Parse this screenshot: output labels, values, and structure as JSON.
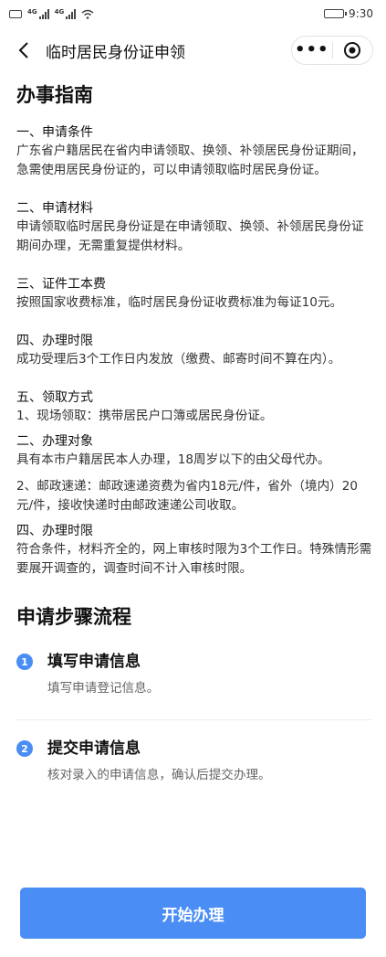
{
  "status_bar": {
    "time": "9:30",
    "battery_level": 0.85
  },
  "nav": {
    "title": "临时居民身份证申领",
    "more_icon": "more-dots-icon",
    "close_icon": "close-circle-icon"
  },
  "guide": {
    "title": "办事指南",
    "sections": [
      {
        "title": "一、申请条件",
        "body": "广东省户籍居民在省内申请领取、换领、补领居民身份证期间，急需使用居民身份证的，可以申请领取临时居民身份证。"
      },
      {
        "title": "二、申请材料",
        "body": "申请领取临时居民身份证是在申请领取、换领、补领居民身份证期间办理，无需重复提供材料。"
      },
      {
        "title": "三、证件工本费",
        "body": "按照国家收费标准，临时居民身份证收费标准为每证10元。"
      },
      {
        "title": "四、办理时限",
        "body": "成功受理后3个工作日内发放（缴费、邮寄时间不算在内）。"
      },
      {
        "title": "五、领取方式",
        "body": "1、现场领取：携带居民户口簿或居民身份证。"
      },
      {
        "title": "二、办理对象",
        "body": "具有本市户籍居民本人办理，18周岁以下的由父母代办。"
      },
      {
        "title": "",
        "body": "2、邮政速递：邮政速递资费为省内18元/件，省外（境内）20元/件，接收快递时由邮政速递公司收取。"
      },
      {
        "title": "四、办理时限",
        "body": "符合条件，材料齐全的，网上审核时限为3个工作日。特殊情形需要展开调查的，调查时间不计入审核时限。"
      }
    ]
  },
  "steps": {
    "title": "申请步骤流程",
    "items": [
      {
        "num": "1",
        "title": "填写申请信息",
        "desc": "填写申请登记信息。"
      },
      {
        "num": "2",
        "title": "提交申请信息",
        "desc": "核对录入的申请信息，确认后提交办理。"
      }
    ]
  },
  "actions": {
    "start_label": "开始办理"
  },
  "colors": {
    "accent": "#4a8ef5",
    "background": "#ffffff"
  }
}
